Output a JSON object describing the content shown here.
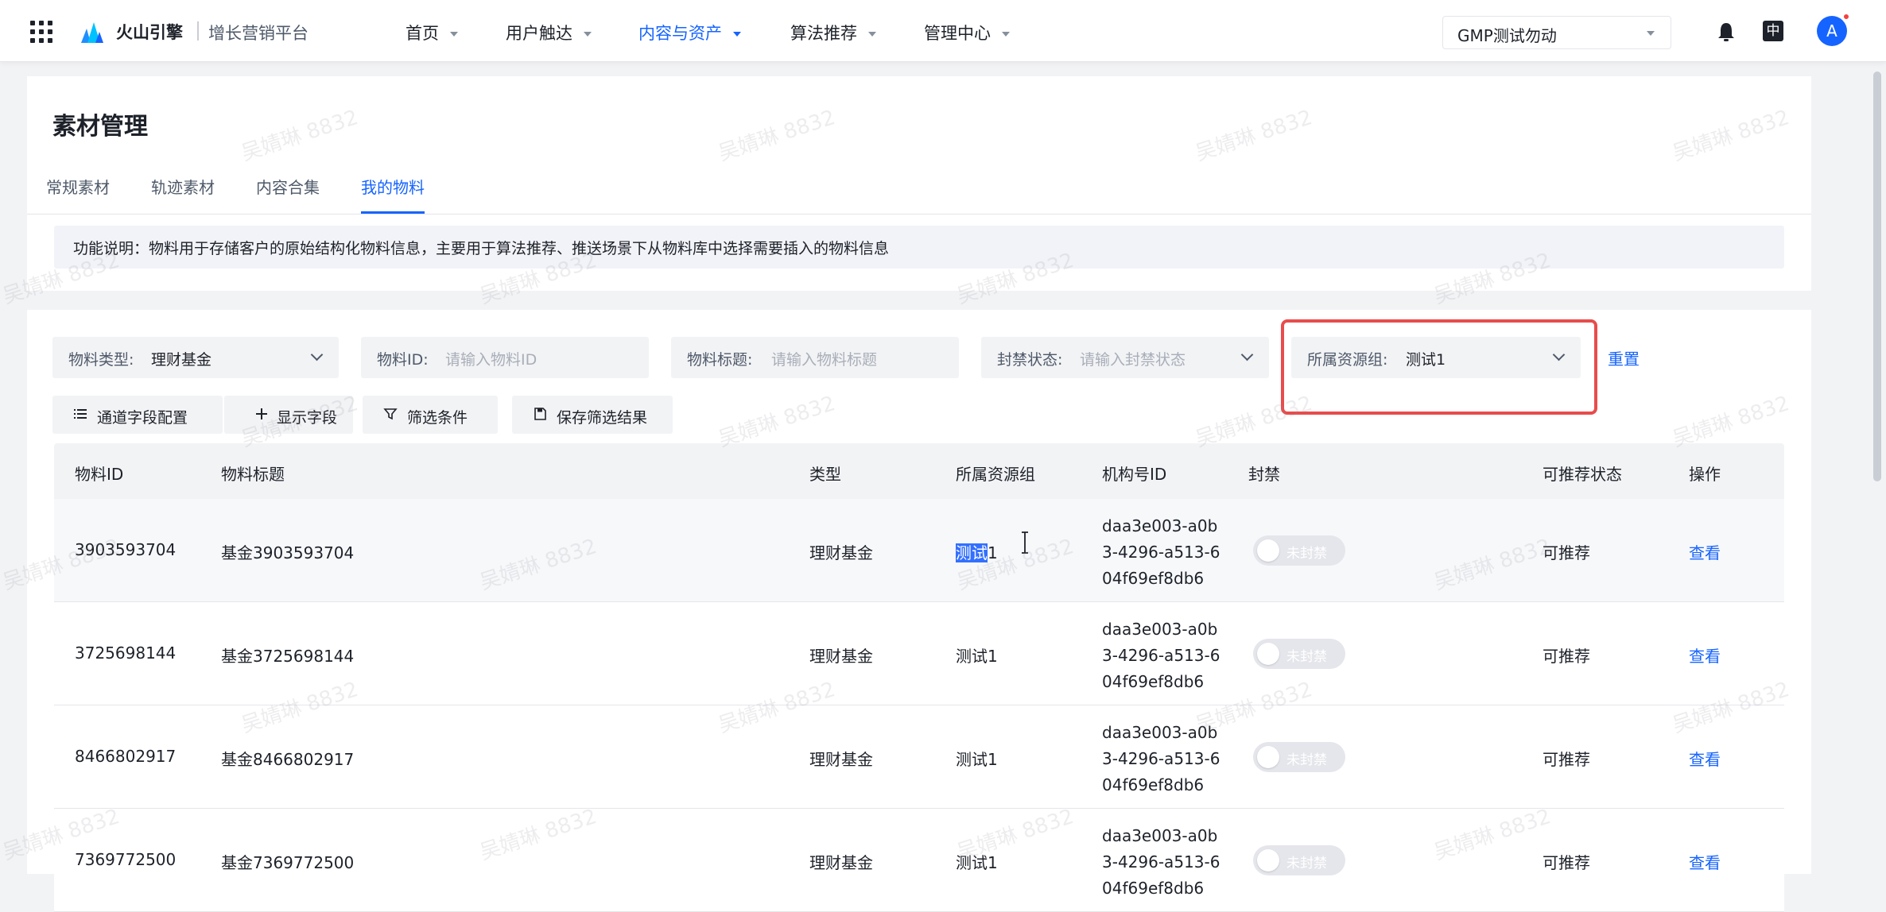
{
  "nav": {
    "brand": "火山引擎",
    "product": "增长营销平台",
    "menu": [
      "首页",
      "用户触达",
      "内容与资产",
      "算法推荐",
      "管理中心"
    ],
    "active_menu": "内容与资产",
    "org": "GMP测试勿动",
    "lang": "中",
    "avatar": "A"
  },
  "page": {
    "title": "素材管理",
    "tabs": [
      "常规素材",
      "轨迹素材",
      "内容合集",
      "我的物料"
    ],
    "active_tab": "我的物料",
    "notice": "功能说明：物料用于存储客户的原始结构化物料信息，主要用于算法推荐、推送场景下从物料库中选择需要插入的物料信息"
  },
  "filters": {
    "type_label": "物料类型:",
    "type_value": "理财基金",
    "id_label": "物料ID:",
    "id_placeholder": "请输入物料ID",
    "title_label": "物料标题:",
    "title_placeholder": "请输入物料标题",
    "ban_label": "封禁状态:",
    "ban_placeholder": "请输入封禁状态",
    "group_label": "所属资源组:",
    "group_value": "测试1",
    "reset": "重置"
  },
  "toolbar": {
    "channel_config": "通道字段配置",
    "show_fields": "显示字段",
    "filter_conditions": "筛选条件",
    "save_filter": "保存筛选结果"
  },
  "table": {
    "headers": [
      "物料ID",
      "物料标题",
      "类型",
      "所属资源组",
      "机构号ID",
      "封禁",
      "可推荐状态",
      "操作"
    ],
    "rows": [
      {
        "id": "3903593704",
        "title": "基金3903593704",
        "type": "理财基金",
        "group_sel": "测试",
        "group_rest": "1",
        "org_lines": [
          "daa3e003-a0b",
          "3-4296-a513-6",
          "04f69ef8db6"
        ],
        "ban": "未封禁",
        "status": "可推荐",
        "action": "查看"
      },
      {
        "id": "3725698144",
        "title": "基金3725698144",
        "type": "理财基金",
        "group_sel": "",
        "group_rest": "测试1",
        "org_lines": [
          "daa3e003-a0b",
          "3-4296-a513-6",
          "04f69ef8db6"
        ],
        "ban": "未封禁",
        "status": "可推荐",
        "action": "查看"
      },
      {
        "id": "8466802917",
        "title": "基金8466802917",
        "type": "理财基金",
        "group_sel": "",
        "group_rest": "测试1",
        "org_lines": [
          "daa3e003-a0b",
          "3-4296-a513-6",
          "04f69ef8db6"
        ],
        "ban": "未封禁",
        "status": "可推荐",
        "action": "查看"
      },
      {
        "id": "7369772500",
        "title": "基金7369772500",
        "type": "理财基金",
        "group_sel": "",
        "group_rest": "测试1",
        "org_lines": [
          "daa3e003-a0b",
          "3-4296-a513-6",
          "04f69ef8db6"
        ],
        "ban": "未封禁",
        "status": "可推荐",
        "action": "查看"
      }
    ]
  },
  "watermark": "吴婧琳 8832",
  "colors": {
    "primary": "#1664ff",
    "highlight": "#e84c4c",
    "selection": "#3370ff"
  }
}
